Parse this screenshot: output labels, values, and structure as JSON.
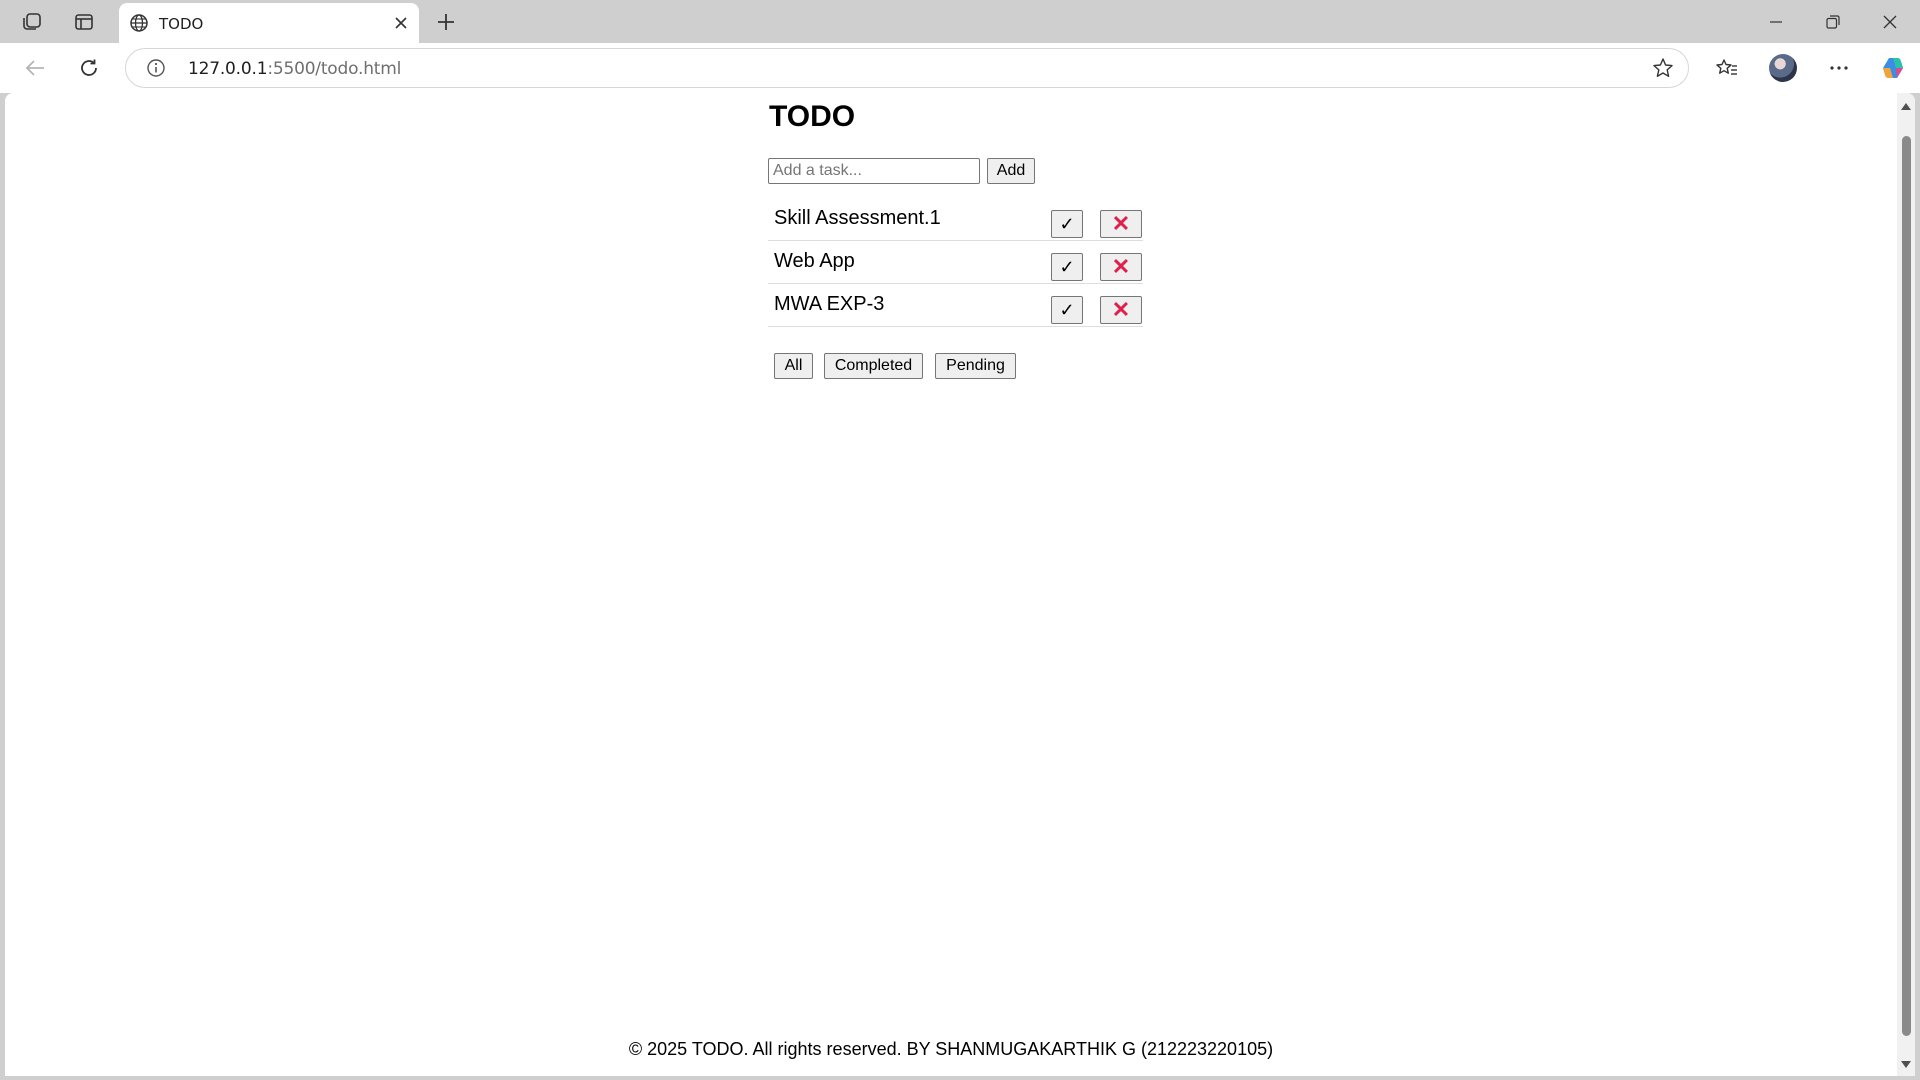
{
  "browser": {
    "tab_title": "TODO",
    "url_host": "127.0.0.1",
    "url_path": ":5500/todo.html",
    "icons": {
      "workspaces": "workspaces-icon",
      "vertical_tabs": "vertical-tabs-icon",
      "tab": "globe-icon",
      "close_tab": "close-icon",
      "new_tab": "plus-icon",
      "back": "back-arrow-icon",
      "reload": "reload-icon",
      "site_info": "info-icon",
      "favorite": "star-icon",
      "favorites": "favorites-icon",
      "more": "more-icon",
      "copilot": "copilot-icon"
    }
  },
  "app": {
    "title": "TODO",
    "input": {
      "placeholder": "Add a task...",
      "value": ""
    },
    "add_label": "Add",
    "tasks": [
      {
        "text": "Skill Assessment.1",
        "done_label": "✓",
        "delete_label": "✕"
      },
      {
        "text": "Web App",
        "done_label": "✓",
        "delete_label": "✕"
      },
      {
        "text": "MWA EXP-3",
        "done_label": "✓",
        "delete_label": "✕"
      }
    ],
    "filters": {
      "all": "All",
      "completed": "Completed",
      "pending": "Pending"
    },
    "footer": "© 2025 TODO. All rights reserved. BY SHANMUGAKARTHIK G (212223220105)"
  },
  "colors": {
    "delete": "#e0204a",
    "page_bg": "#ffffff",
    "chrome_bg": "#cfcfcf"
  }
}
